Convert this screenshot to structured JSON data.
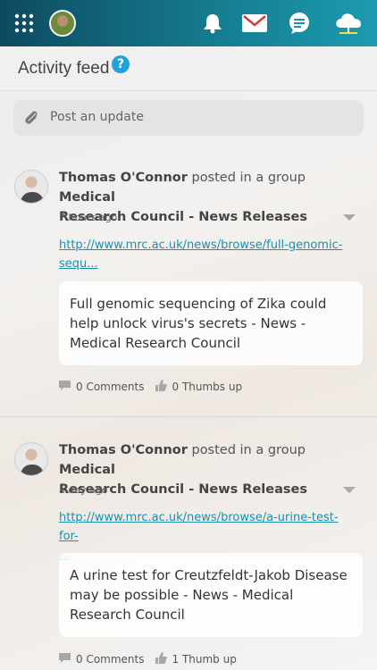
{
  "topbar": {
    "icons": [
      "apps-grid-icon",
      "user-avatar",
      "bell-icon",
      "mail-icon",
      "chat-icon",
      "cloud-icon"
    ]
  },
  "header": {
    "title": "Activity feed",
    "help": "?"
  },
  "composer": {
    "placeholder": "Post an update"
  },
  "feed": [
    {
      "author": "Thomas O'Connor",
      "action": "posted in a group",
      "group_line1": "Medical",
      "group_line2": "Research Council - News Releases",
      "time": "7 hours ago",
      "link_line1": "http://www.mrc.ac.uk/news/browse/full-genomic-",
      "link_line2": "sequ...",
      "preview": "Full genomic sequencing of Zika could help unlock virus's secrets - News - Medical Research Council",
      "comments": "0 Comments",
      "thumbs": "0 Thumbs up"
    },
    {
      "author": "Thomas O'Connor",
      "action": "posted in a group",
      "group_line1": "Medical",
      "group_line2": "Research Council - News Releases",
      "time": "a day ago",
      "link_line1": "http://www.mrc.ac.uk/news/browse/a-urine-test-for-",
      "link_line2": "...",
      "preview": "A urine test for Creutzfeldt-Jakob Disease may be possible - News - Medical Research Council",
      "comments": "0 Comments",
      "thumbs": "1 Thumb up"
    }
  ],
  "colors": {
    "topbar_start": "#0e4a60",
    "topbar_end": "#1d9bb0",
    "link": "#1a8fb0",
    "help_badge": "#1fa3d8"
  }
}
